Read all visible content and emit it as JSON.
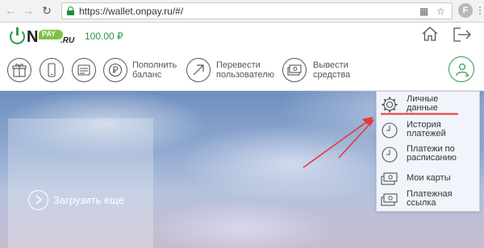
{
  "browser": {
    "url": "https://wallet.onpay.ru/#/",
    "profile_letter": "F"
  },
  "header": {
    "logo_on": "N",
    "logo_pay": "PAY",
    "logo_ru": ".RU",
    "balance": "100.00 ₽"
  },
  "toolbar": {
    "items": [
      {
        "label_line1": "",
        "label_line2": "",
        "icon": "gift-icon"
      },
      {
        "label_line1": "",
        "label_line2": "",
        "icon": "phone-icon"
      },
      {
        "label_line1": "",
        "label_line2": "",
        "icon": "list-icon"
      },
      {
        "label_line1": "Пополнить",
        "label_line2": "баланс",
        "icon": "ruble-icon"
      },
      {
        "label_line1": "Перевести",
        "label_line2": "пользователю",
        "icon": "arrow-up-right-icon"
      },
      {
        "label_line1": "Вывести",
        "label_line2": "средства",
        "icon": "cash-icon"
      }
    ]
  },
  "main": {
    "load_more_label": "Загрузить еще"
  },
  "user_menu": {
    "items": [
      {
        "line1": "Личные",
        "line2": "данные",
        "icon": "gear-icon"
      },
      {
        "line1": "История",
        "line2": "платежей",
        "icon": "clock-icon"
      },
      {
        "line1": "Платежи по",
        "line2": "расписанию",
        "icon": "clock-icon"
      },
      {
        "line1": "Мои карты",
        "line2": "",
        "icon": "card-icon"
      },
      {
        "line1": "Платежная",
        "line2": "ссылка",
        "icon": "card-icon"
      }
    ]
  },
  "colors": {
    "brand_green": "#2c9c4b",
    "logo_pay_green": "#7cc242",
    "annotation_red": "#e53935",
    "menu_bg": "#f1f4fa"
  }
}
